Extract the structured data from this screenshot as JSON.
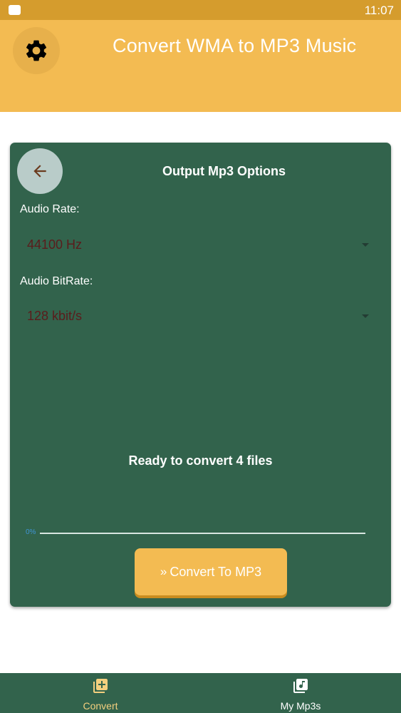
{
  "status_bar": {
    "time": "11:07"
  },
  "header": {
    "title": "Convert WMA to MP3 Music",
    "settings_icon": "gear-icon"
  },
  "options_card": {
    "back_icon": "arrow-left-icon",
    "title": "Output Mp3 Options",
    "audio_rate": {
      "label": "Audio Rate:",
      "value": "44100 Hz"
    },
    "audio_bitrate": {
      "label": "Audio BitRate:",
      "value": "128 kbit/s"
    },
    "ready_text": "Ready to convert 4 files",
    "progress": {
      "label": "0%",
      "percent": 0
    },
    "convert_button": {
      "chevron": "»",
      "label": "Convert To MP3"
    }
  },
  "bottom_nav": {
    "items": [
      {
        "label": "Convert",
        "icon": "add-file-icon",
        "active": true
      },
      {
        "label": "My Mp3s",
        "icon": "music-library-icon",
        "active": false
      }
    ]
  },
  "colors": {
    "status_bar": "#d59c2d",
    "header": "#f3bb52",
    "card": "#32634c",
    "accent": "#f3bb52",
    "dropdown_text": "#5a1c1c",
    "progress": "#3f95d6",
    "nav_active": "#f3cf7e"
  }
}
